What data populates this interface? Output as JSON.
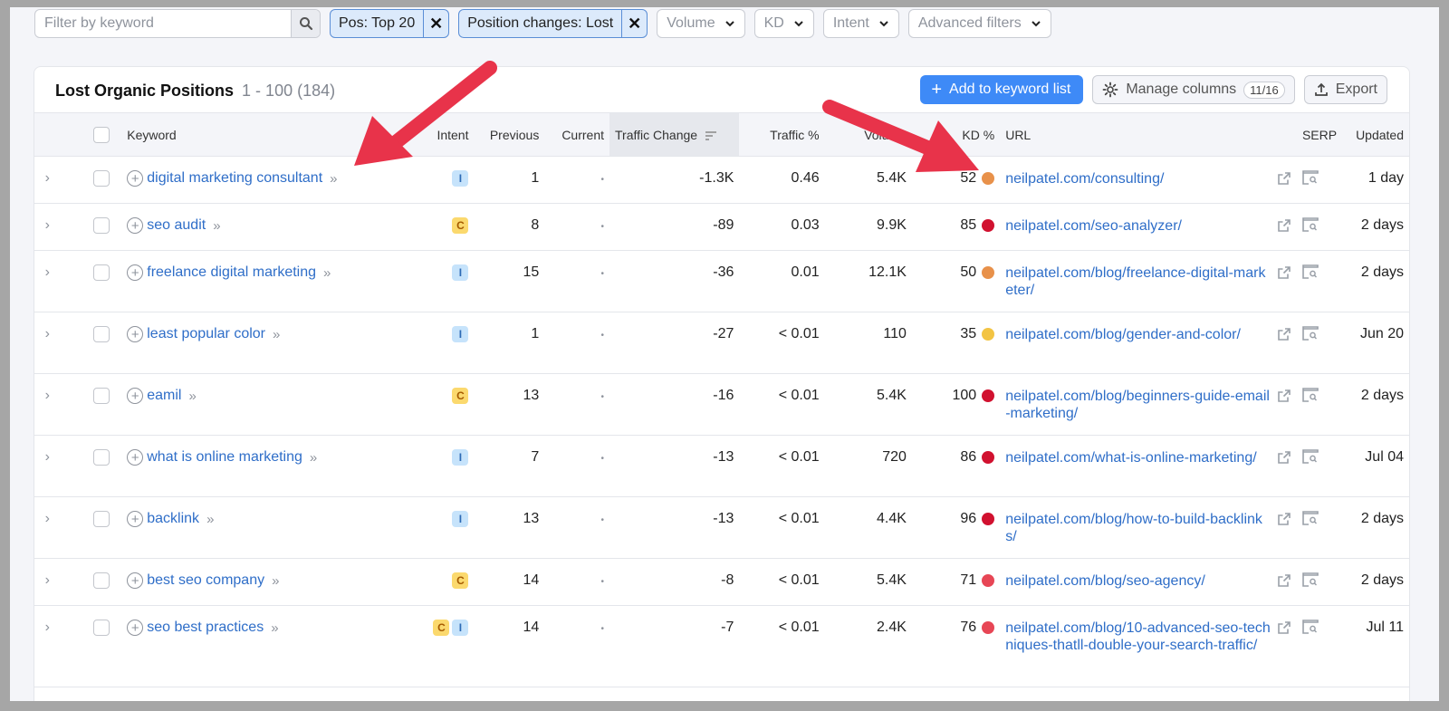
{
  "filters": {
    "search_placeholder": "Filter by keyword",
    "chips": [
      {
        "label": "Pos: Top 20"
      },
      {
        "label": "Position changes: Lost"
      }
    ],
    "dropdowns": [
      {
        "label": "Volume"
      },
      {
        "label": "KD"
      },
      {
        "label": "Intent"
      },
      {
        "label": "Advanced filters"
      }
    ]
  },
  "header": {
    "title": "Lost Organic Positions",
    "range": "1 - 100 (184)",
    "add_button": "Add to keyword list",
    "manage_button": "Manage columns",
    "manage_count": "11/16",
    "export_button": "Export"
  },
  "columns": {
    "keyword": "Keyword",
    "intent": "Intent",
    "previous": "Previous",
    "current": "Current",
    "traffic_change": "Traffic Change",
    "traffic_pct": "Traffic %",
    "volume": "Volume",
    "kd": "KD %",
    "url": "URL",
    "serp": "SERP",
    "updated": "Updated"
  },
  "colors": {
    "kd_orange": "#e8914a",
    "kd_red": "#d1112f",
    "kd_yellow": "#f3c443",
    "kd_pink": "#e74655",
    "accent": "#3e8af7",
    "arrow": "#e8334a"
  },
  "rows": [
    {
      "keyword": "digital marketing consultant",
      "intent": [
        "I"
      ],
      "previous": "1",
      "current": "•",
      "traffic_change": "-1.3K",
      "traffic_pct": "0.46",
      "volume": "5.4K",
      "kd": "52",
      "kd_color": "#e8914a",
      "url": "neilpatel.com/consulting/",
      "updated": "1 day"
    },
    {
      "keyword": "seo audit",
      "intent": [
        "C"
      ],
      "previous": "8",
      "current": "•",
      "traffic_change": "-89",
      "traffic_pct": "0.03",
      "volume": "9.9K",
      "kd": "85",
      "kd_color": "#d1112f",
      "url": "neilpatel.com/seo-analyzer/",
      "updated": "2 days"
    },
    {
      "keyword": "freelance digital marketing",
      "intent": [
        "I"
      ],
      "previous": "15",
      "current": "•",
      "traffic_change": "-36",
      "traffic_pct": "0.01",
      "volume": "12.1K",
      "kd": "50",
      "kd_color": "#e8914a",
      "url": "neilpatel.com/blog/freelance-digital-marketer/",
      "updated": "2 days"
    },
    {
      "keyword": "least popular color",
      "intent": [
        "I"
      ],
      "previous": "1",
      "current": "•",
      "traffic_change": "-27",
      "traffic_pct": "< 0.01",
      "volume": "110",
      "kd": "35",
      "kd_color": "#f3c443",
      "url": "neilpatel.com/blog/gender-and-color/",
      "updated": "Jun 20"
    },
    {
      "keyword": "eamil",
      "intent": [
        "C"
      ],
      "previous": "13",
      "current": "•",
      "traffic_change": "-16",
      "traffic_pct": "< 0.01",
      "volume": "5.4K",
      "kd": "100",
      "kd_color": "#d1112f",
      "url": "neilpatel.com/blog/beginners-guide-email-marketing/",
      "updated": "2 days"
    },
    {
      "keyword": "what is online marketing",
      "intent": [
        "I"
      ],
      "previous": "7",
      "current": "•",
      "traffic_change": "-13",
      "traffic_pct": "< 0.01",
      "volume": "720",
      "kd": "86",
      "kd_color": "#d1112f",
      "url": "neilpatel.com/what-is-online-marketing/",
      "updated": "Jul 04"
    },
    {
      "keyword": "backlink",
      "intent": [
        "I"
      ],
      "previous": "13",
      "current": "•",
      "traffic_change": "-13",
      "traffic_pct": "< 0.01",
      "volume": "4.4K",
      "kd": "96",
      "kd_color": "#d1112f",
      "url": "neilpatel.com/blog/how-to-build-backlinks/",
      "updated": "2 days"
    },
    {
      "keyword": "best seo company",
      "intent": [
        "C"
      ],
      "previous": "14",
      "current": "•",
      "traffic_change": "-8",
      "traffic_pct": "< 0.01",
      "volume": "5.4K",
      "kd": "71",
      "kd_color": "#e74655",
      "url": "neilpatel.com/blog/seo-agency/",
      "updated": "2 days"
    },
    {
      "keyword": "seo best practices",
      "intent": [
        "C",
        "I"
      ],
      "previous": "14",
      "current": "•",
      "traffic_change": "-7",
      "traffic_pct": "< 0.01",
      "volume": "2.4K",
      "kd": "76",
      "kd_color": "#e74655",
      "url": "neilpatel.com/blog/10-advanced-seo-techniques-thatll-double-your-search-traffic/",
      "updated": "Jul 11"
    }
  ]
}
